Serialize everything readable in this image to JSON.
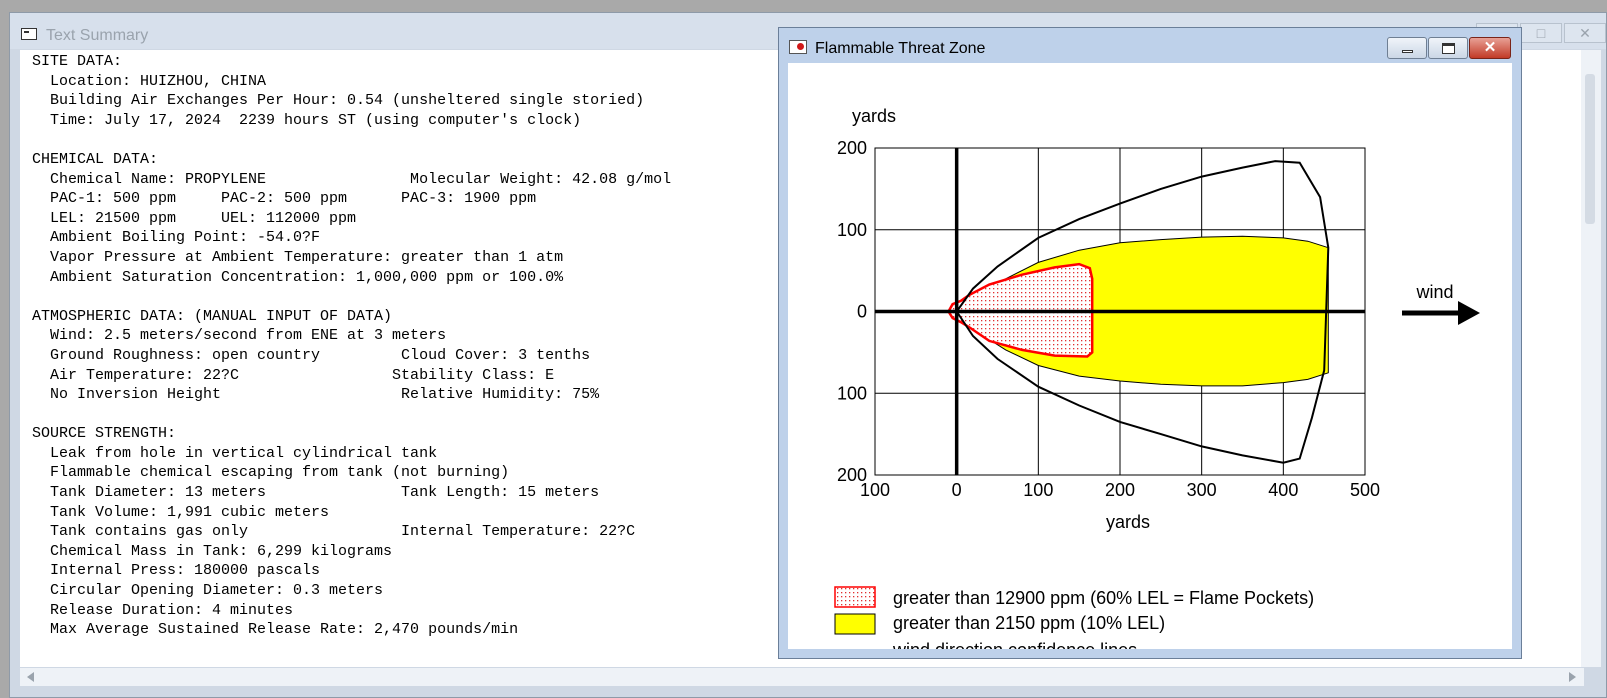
{
  "text_summary": {
    "title": "Text Summary",
    "lines": [
      "SITE DATA:",
      "  Location: HUIZHOU, CHINA",
      "  Building Air Exchanges Per Hour: 0.54 (unsheltered single storied)",
      "  Time: July 17, 2024  2239 hours ST (using computer's clock)",
      "",
      "CHEMICAL DATA:",
      "  Chemical Name: PROPYLENE                Molecular Weight: 42.08 g/mol",
      "  PAC-1: 500 ppm     PAC-2: 500 ppm      PAC-3: 1900 ppm",
      "  LEL: 21500 ppm     UEL: 112000 ppm",
      "  Ambient Boiling Point: -54.0?F",
      "  Vapor Pressure at Ambient Temperature: greater than 1 atm",
      "  Ambient Saturation Concentration: 1,000,000 ppm or 100.0%",
      "",
      "ATMOSPHERIC DATA: (MANUAL INPUT OF DATA)",
      "  Wind: 2.5 meters/second from ENE at 3 meters",
      "  Ground Roughness: open country         Cloud Cover: 3 tenths",
      "  Air Temperature: 22?C                 Stability Class: E",
      "  No Inversion Height                    Relative Humidity: 75%",
      "",
      "SOURCE STRENGTH:",
      "  Leak from hole in vertical cylindrical tank",
      "  Flammable chemical escaping from tank (not burning)",
      "  Tank Diameter: 13 meters               Tank Length: 15 meters",
      "  Tank Volume: 1,991 cubic meters",
      "  Tank contains gas only                 Internal Temperature: 22?C",
      "  Chemical Mass in Tank: 6,299 kilograms",
      "  Internal Press: 180000 pascals",
      "  Circular Opening Diameter: 0.3 meters",
      "  Release Duration: 4 minutes",
      "  Max Average Sustained Release Rate: 2,470 pounds/min"
    ]
  },
  "threat_zone": {
    "title": "Flammable Threat Zone",
    "wind_label": "wind",
    "legend": [
      {
        "label": "greater than 12900 ppm (60% LEL = Flame Pockets)",
        "swatch": "red-dotted"
      },
      {
        "label": "greater than 2150 ppm (10% LEL)",
        "swatch": "yellow"
      },
      {
        "label": "wind direction confidence lines",
        "swatch": "dash"
      }
    ]
  },
  "chart_data": {
    "type": "area",
    "xlabel": "yards",
    "ylabel": "yards",
    "xlim": [
      -100,
      500
    ],
    "ylim": [
      -200,
      200
    ],
    "x_ticks": [
      -100,
      0,
      100,
      200,
      300,
      400,
      500
    ],
    "x_tick_labels": [
      "100",
      "0",
      "100",
      "200",
      "300",
      "400",
      "500"
    ],
    "y_ticks": [
      200,
      100,
      0,
      -100,
      -200
    ],
    "y_tick_labels": [
      "200",
      "100",
      "0",
      "100",
      "200"
    ],
    "grid": true,
    "colors": {
      "flame_pockets": "#ff0000",
      "lel10": "#ffff00",
      "outline": "#000000"
    },
    "series": [
      {
        "name": "greater than 2150 ppm (10% LEL)",
        "points": [
          [
            0,
            0
          ],
          [
            10,
            10
          ],
          [
            30,
            25
          ],
          [
            60,
            40
          ],
          [
            100,
            60
          ],
          [
            150,
            75
          ],
          [
            200,
            84
          ],
          [
            250,
            88
          ],
          [
            300,
            91
          ],
          [
            350,
            92
          ],
          [
            400,
            90
          ],
          [
            430,
            86
          ],
          [
            455,
            78
          ],
          [
            455,
            -75
          ],
          [
            430,
            -83
          ],
          [
            400,
            -87
          ],
          [
            350,
            -91
          ],
          [
            300,
            -91
          ],
          [
            250,
            -89
          ],
          [
            200,
            -85
          ],
          [
            150,
            -79
          ],
          [
            100,
            -66
          ],
          [
            60,
            -47
          ],
          [
            30,
            -28
          ],
          [
            10,
            -12
          ],
          [
            0,
            0
          ]
        ]
      },
      {
        "name": "greater than 12900 ppm (60% LEL = Flame Pockets)",
        "points": [
          [
            -10,
            0
          ],
          [
            -5,
            9
          ],
          [
            5,
            13
          ],
          [
            15,
            20
          ],
          [
            40,
            33
          ],
          [
            80,
            45
          ],
          [
            120,
            54
          ],
          [
            150,
            58
          ],
          [
            163,
            53
          ],
          [
            166,
            40
          ],
          [
            166,
            -50
          ],
          [
            160,
            -55
          ],
          [
            120,
            -54
          ],
          [
            80,
            -47
          ],
          [
            40,
            -36
          ],
          [
            15,
            -19
          ],
          [
            5,
            -13
          ],
          [
            -5,
            -8
          ],
          [
            -10,
            0
          ]
        ]
      },
      {
        "name": "wind direction confidence lines",
        "points": [
          [
            0,
            0
          ],
          [
            20,
            28
          ],
          [
            50,
            55
          ],
          [
            100,
            90
          ],
          [
            150,
            113
          ],
          [
            200,
            132
          ],
          [
            250,
            150
          ],
          [
            300,
            165
          ],
          [
            350,
            176
          ],
          [
            390,
            184
          ],
          [
            420,
            182
          ],
          [
            445,
            140
          ],
          [
            455,
            78
          ],
          [
            450,
            -72
          ],
          [
            435,
            -130
          ],
          [
            420,
            -180
          ],
          [
            400,
            -185
          ],
          [
            350,
            -176
          ],
          [
            300,
            -165
          ],
          [
            250,
            -150
          ],
          [
            200,
            -135
          ],
          [
            150,
            -115
          ],
          [
            100,
            -92
          ],
          [
            50,
            -58
          ],
          [
            20,
            -30
          ],
          [
            0,
            0
          ]
        ]
      }
    ]
  }
}
